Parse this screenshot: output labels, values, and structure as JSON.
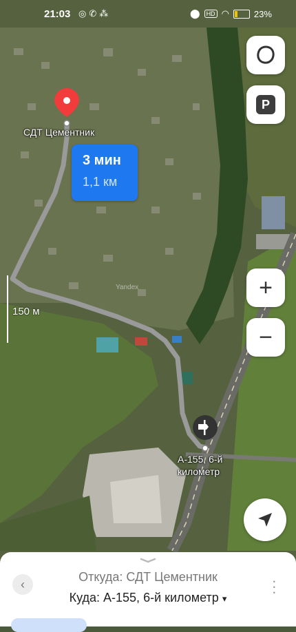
{
  "status_bar": {
    "time": "21:03",
    "left_icons": [
      "instagram-icon",
      "whatsapp-icon",
      "dots-icon"
    ],
    "right_icons": [
      "location-icon",
      "hd-icon",
      "wifi-icon"
    ],
    "battery_percent": "23%",
    "battery_level": 0.23
  },
  "map": {
    "scale_label": "150 м",
    "start_label": "СДТ Цементник",
    "end_label": "А-155, 6-й километр",
    "watermark": "Yandex"
  },
  "route_bubble": {
    "time": "3 мин",
    "distance": "1,1 км"
  },
  "controls": {
    "zoom_in": "+",
    "zoom_out": "−",
    "parking": "P"
  },
  "sheet": {
    "from": "Откуда: СДТ Цементник",
    "to": "Куда: А-155, 6-й километр",
    "to_chevron": "▾"
  },
  "colors": {
    "route_line": "#9a9a9a",
    "eta_bubble": "#1e78f0",
    "start_pin": "#f23b3b",
    "battery": "#f2c200"
  }
}
